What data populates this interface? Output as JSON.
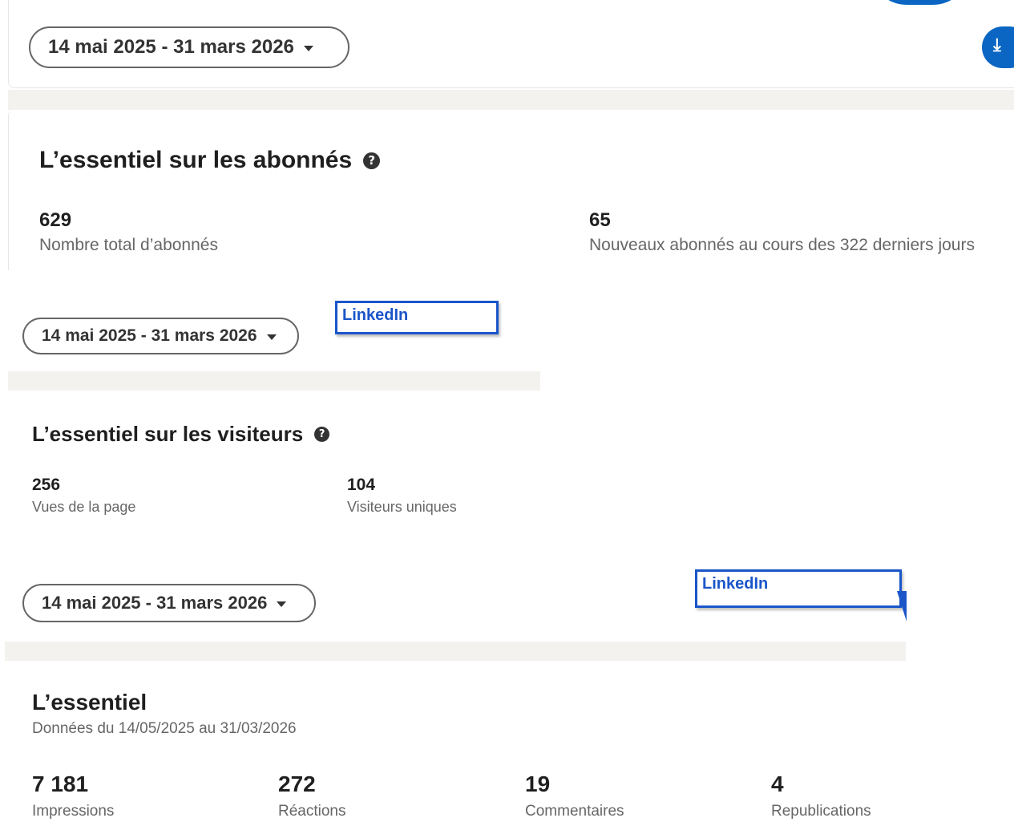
{
  "panel1": {
    "date_range": "14 mai 2025 - 31 mars 2026",
    "title": "L’essentiel sur les abonnés",
    "help_icon": "question-circle-icon",
    "stats": [
      {
        "value": "629",
        "label": "Nombre total d’abonnés"
      },
      {
        "value": "65",
        "label": "Nouveaux abonnés au cours des 322 derniers jours"
      }
    ]
  },
  "panel2": {
    "date_range": "14 mai 2025 - 31 mars 2026",
    "brand_label": "LinkedIn",
    "title": "L’essentiel sur les visiteurs",
    "help_icon": "question-circle-icon",
    "stats": [
      {
        "value": "256",
        "label": "Vues de la page"
      },
      {
        "value": "104",
        "label": "Visiteurs uniques"
      }
    ]
  },
  "panel3": {
    "date_range": "14 mai 2025 - 31 mars 2026",
    "brand_label": "LinkedIn",
    "title": "L’essentiel",
    "subtitle": "Données du 14/05/2025 au 31/03/2026",
    "stats": [
      {
        "value": "7 181",
        "label": "Impressions"
      },
      {
        "value": "272",
        "label": "Réactions"
      },
      {
        "value": "19",
        "label": "Commentaires"
      },
      {
        "value": "4",
        "label": "Republications"
      }
    ]
  },
  "colors": {
    "accent_blue": "#0a66c2",
    "linkedin_box": "#1a55c9",
    "page_gray": "#f3f2ef",
    "muted_text": "#666666"
  }
}
